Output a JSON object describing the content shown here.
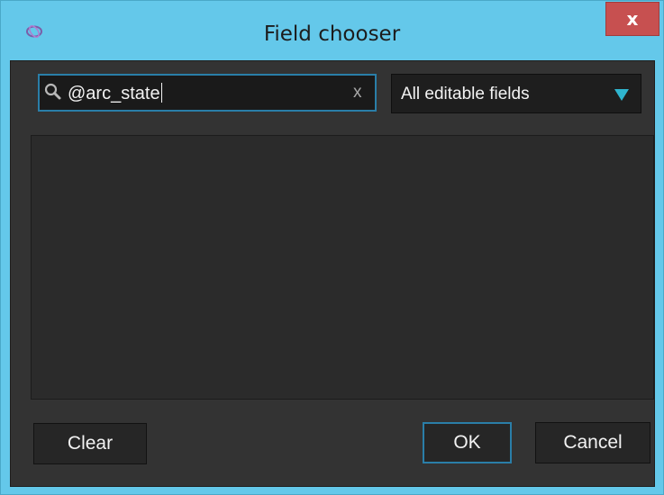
{
  "window": {
    "title": "Field chooser",
    "close_label": "x",
    "app_icon": "app-icon",
    "colors": {
      "titlebar": "#64c8ea",
      "close": "#c75050",
      "client": "#333333",
      "focus": "#2a7ea8",
      "dropdown_arrow": "#2fb5cf"
    }
  },
  "search": {
    "value": "@arc_state",
    "icon": "search-icon",
    "clear_label": "x"
  },
  "filter": {
    "selected": "All editable fields",
    "icon": "chevron-down-icon"
  },
  "field_list": {
    "items": []
  },
  "buttons": {
    "clear": "Clear",
    "ok": "OK",
    "cancel": "Cancel"
  }
}
